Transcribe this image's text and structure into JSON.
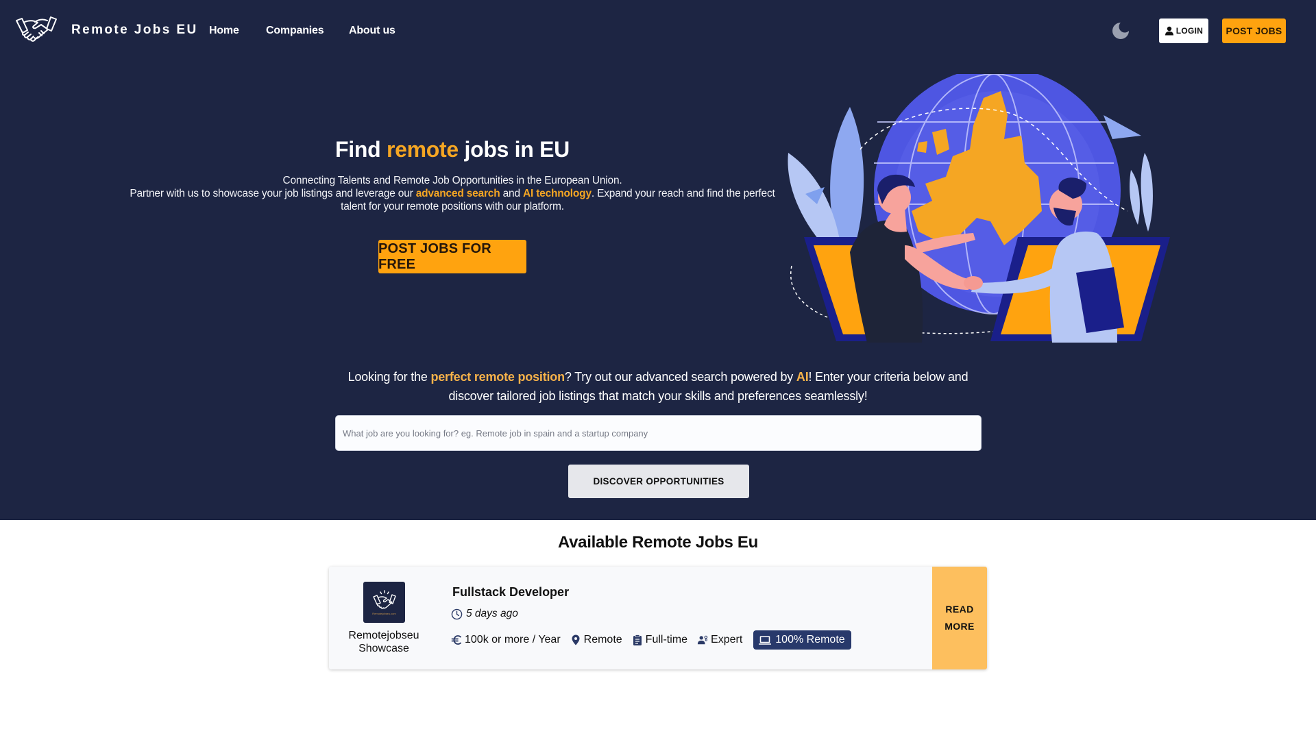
{
  "nav": {
    "brand": "Remote Jobs EU",
    "logo_icon": "handshake-icon",
    "links": [
      {
        "label": "Home"
      },
      {
        "label": "Companies"
      },
      {
        "label": "About us"
      }
    ],
    "theme_toggle_icon": "moon-icon",
    "login_label": "LOGIN",
    "login_icon": "user-icon",
    "post_jobs_label": "POST JOBS"
  },
  "hero": {
    "title_before": "Find ",
    "title_accent": "remote",
    "title_after": " jobs in EU",
    "line1": "Connecting Talents and Remote Job Opportunities in the European Union.",
    "line2_before": "Partner with us to showcase your job listings and leverage our ",
    "line2_accent1": "advanced search",
    "line2_mid": " and ",
    "line2_accent2": "AI technology",
    "line2_after": ". Expand your reach and find the perfect talent for your remote positions with our platform.",
    "cta_label": "POST JOBS FOR FREE",
    "illustration": "people-handshake-over-europe-globe-illustration"
  },
  "search": {
    "intro_before": "Looking for the ",
    "intro_accent1": "perfect remote position",
    "intro_mid": "? Try out our advanced search powered by ",
    "intro_accent2": "AI",
    "intro_after": "! Enter your criteria below and discover tailored job listings that match your skills and preferences seamlessly!",
    "value": "",
    "placeholder": "What job are you looking for? eg. Remote job in spain and a startup company",
    "button_label": "DISCOVER OPPORTUNITIES"
  },
  "jobs": {
    "section_title": "Available Remote Jobs Eu",
    "items": [
      {
        "company": "Remotejobseu Showcase",
        "company_logo_caption": "Remotejobseu.com",
        "title": "Fullstack Developer",
        "posted": "5 days ago",
        "salary": "100k or more / Year",
        "location": "Remote",
        "employment_type": "Full-time",
        "level": "Expert",
        "remote_badge": "100% Remote",
        "read_more_label": "READ MORE"
      }
    ]
  },
  "colors": {
    "hero_bg": "#1d2543",
    "accent": "#ffa30f",
    "accent_text": "#f5a623",
    "badge_bg": "#28396b",
    "read_more_bg": "#fdbf5e",
    "icon": "#2b3a66"
  }
}
